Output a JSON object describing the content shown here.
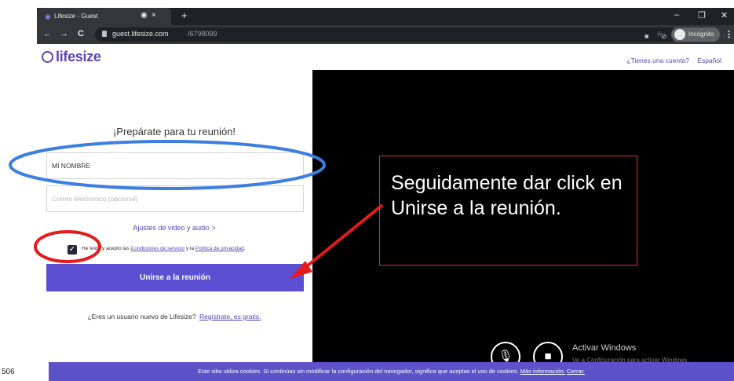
{
  "browser": {
    "tab_title": "Lifesize - Guest",
    "tab_close": "×",
    "tab_audio": "◉",
    "new_tab": "+",
    "url_host": "guest.lifesize.com",
    "url_path": "/6798099",
    "back": "←",
    "forward": "→",
    "reload": "C",
    "profile": "Incógnito",
    "menu": "⋮",
    "minimize": "–",
    "maximize": "❐",
    "close": "✕"
  },
  "page": {
    "logo": "lifesize",
    "has_account_link": "¿Tienes una cuenta?",
    "language_link": "Español",
    "heading": "¡Prepárate para tu reunión!",
    "name_value": "MI NOMBRE",
    "email_placeholder": "Correo electrónico (opcional)",
    "av_settings_link": "Ajustes de video y audio >",
    "terms_prefix": "He leído y acepto las ",
    "terms_link": "Condiciones de servicio",
    "terms_middle": " y la ",
    "privacy_link": "Política de privacidad",
    "terms_suffix": ".",
    "join_button": "Unirse a la reunión",
    "new_user_text": "¿Eres un usuario nuevo de Lifesize?",
    "signup_link": "Regístrate, es gratis."
  },
  "video": {
    "windows_activate_title": "Activar Windows",
    "windows_activate_sub": "Ve a Configuración para activar Windows."
  },
  "cookie": {
    "text": "Este sitio utiliza cookies. Si continúas sin modificar la configuración del navegador, significa que aceptas el uso de cookies. ",
    "more_link": "Más información.",
    "close_link": "Cerrar."
  },
  "annotation": {
    "callout_text": "Seguidamente dar click en Unirse a la reunión.",
    "page_number": "506",
    "ellipse_color": "#3d7fe0",
    "circle_color": "#e31b1b",
    "arrow_color": "#e31b1b"
  }
}
